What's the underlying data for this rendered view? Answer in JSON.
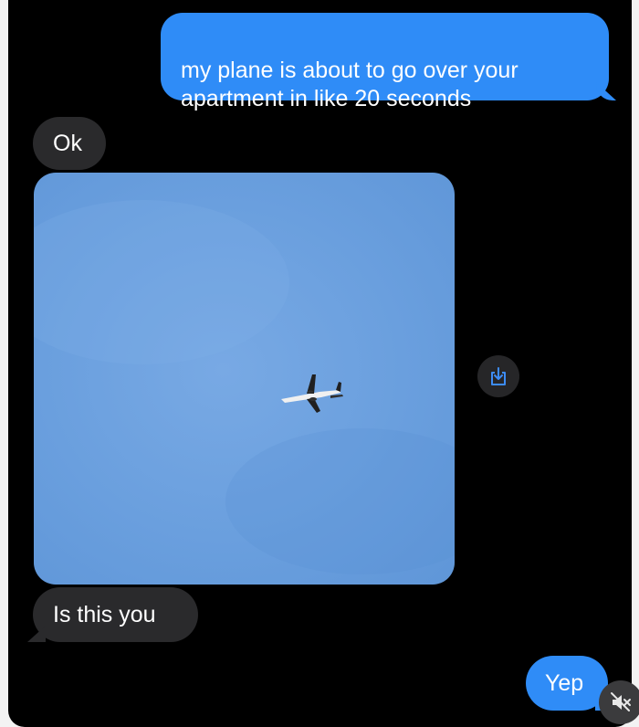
{
  "conversation": {
    "messages": [
      {
        "sender": "me",
        "text": "my plane is about to go over your\napartment in like 20 seconds"
      },
      {
        "sender": "them",
        "text": "Ok"
      },
      {
        "sender": "them",
        "type": "photo",
        "content": "airplane in clear blue sky"
      },
      {
        "sender": "them",
        "text": "Is this you"
      },
      {
        "sender": "me",
        "text": "Yep"
      }
    ]
  },
  "controls": {
    "save_icon": "save-to-device-icon",
    "mute_icon": "speaker-muted-icon"
  },
  "colors": {
    "outgoing_bubble": "#2f8cf7",
    "incoming_bubble": "#2a2a2c",
    "background": "#000000",
    "sky": "#6a9fde"
  }
}
